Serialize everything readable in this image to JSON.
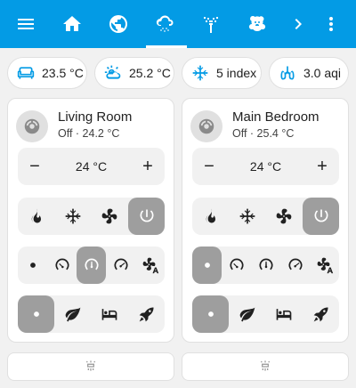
{
  "toolbar": {
    "tabs": [
      "menu-icon",
      "home-icon",
      "globe-icon",
      "weather-snowy-icon",
      "sprinkler-icon",
      "teddy-bear-icon",
      "chevron-right-icon",
      "more-vertical-icon"
    ],
    "active_tab": "weather-snowy-icon",
    "color": "#039be5"
  },
  "chips": [
    {
      "icon": "sofa-icon",
      "value": "23.5 °C",
      "icon_color": "#039be5"
    },
    {
      "icon": "weather-partly-cloudy-icon",
      "value": "25.2 °C",
      "icon_color": "#039be5"
    },
    {
      "icon": "snowflake-index-icon",
      "value": "5 index",
      "icon_color": "#039be5"
    },
    {
      "icon": "lungs-icon",
      "value": "3.0 aqi",
      "icon_color": "#039be5"
    }
  ],
  "thermostats": [
    {
      "name": "Living Room",
      "state": "Off · 24.2 °C",
      "setpoint": "24 °C",
      "minus": "−",
      "plus": "+",
      "active_mode": "power",
      "active_fan": "medium",
      "active_preset": "none"
    },
    {
      "name": "Main Bedroom",
      "state": "Off · 25.4 °C",
      "setpoint": "24 °C",
      "minus": "−",
      "plus": "+",
      "active_mode": "power",
      "active_fan": "dot",
      "active_preset": "none"
    }
  ]
}
